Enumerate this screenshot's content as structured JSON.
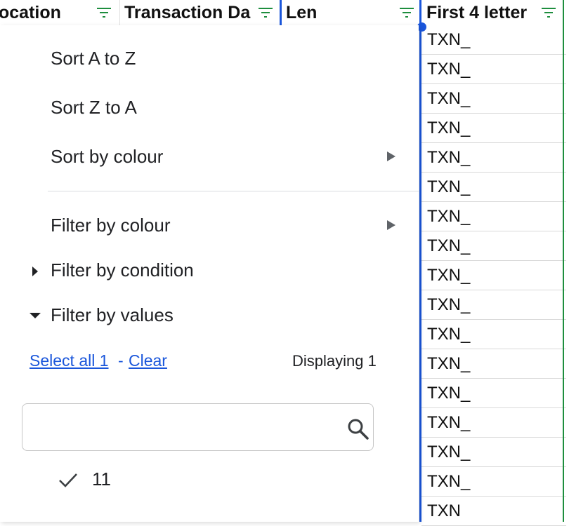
{
  "header": {
    "col_location": "ocation",
    "col_transaction_date": "Transaction Da",
    "col_len": "Len",
    "col_first4": "First 4 letter"
  },
  "column_values": [
    "TXN_",
    "TXN_",
    "TXN_",
    "TXN_",
    "TXN_",
    "TXN_",
    "TXN_",
    "TXN_",
    "TXN_",
    "TXN_",
    "TXN_",
    "TXN_",
    "TXN_",
    "TXN_",
    "TXN_",
    "TXN_",
    "TXN"
  ],
  "menu": {
    "sort_a_z": "Sort A to Z",
    "sort_z_a": "Sort Z to A",
    "sort_colour": "Sort by colour",
    "filter_colour": "Filter by colour",
    "filter_condition": "Filter by condition",
    "filter_values": "Filter by values",
    "select_all": "Select all 1",
    "dash": "-",
    "clear": "Clear",
    "displaying": "Displaying 1",
    "search_value": "",
    "search_placeholder": "",
    "values": [
      "11"
    ]
  },
  "colors": {
    "accent": "#1a56db",
    "filter_icon": "#1e8e3e"
  },
  "icons": [
    "filter-icon",
    "submenu-arrow-icon",
    "expand-right-icon",
    "collapse-down-icon",
    "search-icon",
    "checkmark-icon"
  ]
}
